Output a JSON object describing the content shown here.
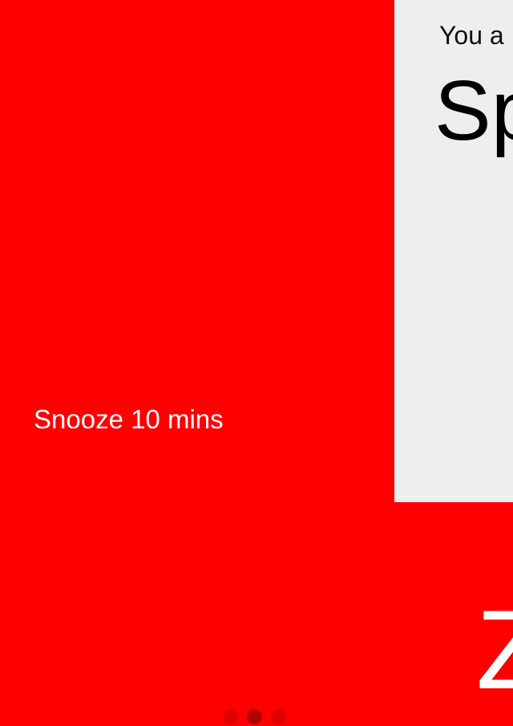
{
  "snooze": {
    "label": "Snooze 10 mins"
  },
  "info_card": {
    "subtitle": "You a",
    "title": "Sp"
  },
  "next_panel": {
    "glyph": "Z"
  },
  "pager": {
    "count": 3,
    "active_index": 1
  },
  "colors": {
    "accent_red": "#ff0000",
    "card_background": "#eeeeee",
    "text_light": "#ffffff",
    "text_dark": "#000000"
  }
}
